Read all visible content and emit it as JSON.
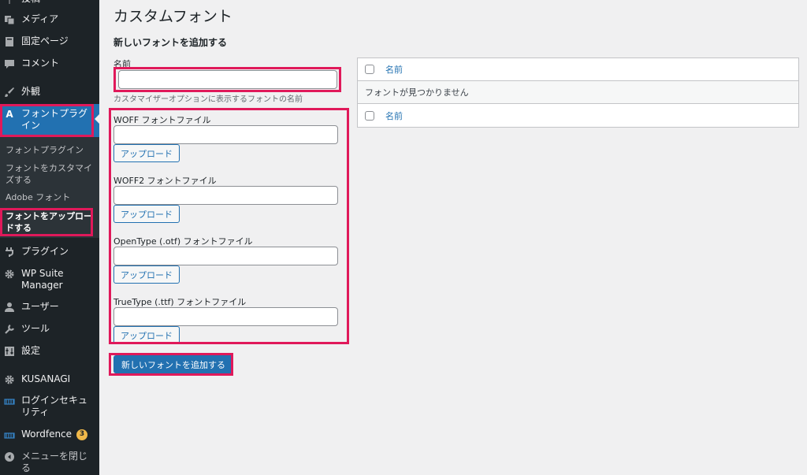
{
  "sidebar": {
    "items": [
      {
        "label": "投稿",
        "icon": "pin-icon"
      },
      {
        "label": "メディア",
        "icon": "media-icon"
      },
      {
        "label": "固定ページ",
        "icon": "page-icon"
      },
      {
        "label": "コメント",
        "icon": "comment-icon"
      },
      {
        "label": "外観",
        "icon": "appearance-icon"
      },
      {
        "label": "フォントプラグイン",
        "icon": "font-a-icon"
      },
      {
        "label": "プラグイン",
        "icon": "plugin-icon"
      },
      {
        "label": "WP Suite Manager",
        "icon": "gear-icon"
      },
      {
        "label": "ユーザー",
        "icon": "user-icon"
      },
      {
        "label": "ツール",
        "icon": "wrench-icon"
      },
      {
        "label": "設定",
        "icon": "settings-icon"
      },
      {
        "label": "KUSANAGI",
        "icon": "gear-icon"
      },
      {
        "label": "ログインセキュリティ",
        "icon": "shield-icon"
      },
      {
        "label": "Wordfence",
        "icon": "wordfence-icon",
        "badge": "3"
      },
      {
        "label": "メニューを閉じる",
        "icon": "collapse-icon"
      }
    ],
    "submenu": [
      {
        "label": "フォントプラグイン"
      },
      {
        "label": "フォントをカスタマイズする"
      },
      {
        "label": "Adobe フォント"
      },
      {
        "label": "フォントをアップロードする"
      }
    ]
  },
  "main": {
    "title": "カスタムフォント",
    "section_title": "新しいフォントを追加する",
    "name_label": "名前",
    "name_value": "",
    "name_description": "カスタマイザーオプションに表示するフォントの名前",
    "file_fields": [
      {
        "label": "WOFF フォントファイル",
        "value": "",
        "button": "アップロード"
      },
      {
        "label": "WOFF2 フォントファイル",
        "value": "",
        "button": "アップロード"
      },
      {
        "label": "OpenType (.otf) フォントファイル",
        "value": "",
        "button": "アップロード"
      },
      {
        "label": "TrueType (.ttf) フォントファイル",
        "value": "",
        "button": "アップロード"
      }
    ],
    "submit_label": "新しいフォントを追加する"
  },
  "table": {
    "header": "名前",
    "empty_message": "フォントが見つかりません",
    "footer": "名前"
  },
  "colors": {
    "sidebar_bg": "#1d2327",
    "accent": "#2271b1",
    "highlight": "#e0195a",
    "badge": "#f0b849"
  }
}
